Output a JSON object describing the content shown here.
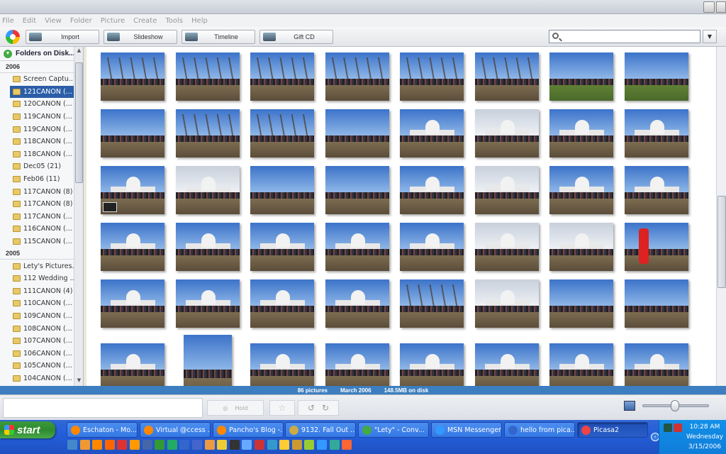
{
  "menu": [
    "File",
    "Edit",
    "View",
    "Folder",
    "Picture",
    "Create",
    "Tools",
    "Help"
  ],
  "toolbar": {
    "import": "Import",
    "slideshow": "Slideshow",
    "timeline": "Timeline",
    "giftcd": "Gift CD"
  },
  "search": {
    "value": ""
  },
  "sidebar": {
    "header": "Folders on Disk...",
    "year_2006": "2006",
    "folders_2006": [
      "Screen Captu...",
      "121CANON (...",
      "120CANON (...",
      "119CANON (...",
      "119CANON (...",
      "118CANON (...",
      "118CANON (...",
      "Dec05 (21)",
      "Feb06 (11)",
      "117CANON (8)",
      "117CANON (8)",
      "117CANON (...",
      "116CANON (...",
      "115CANON (..."
    ],
    "year_2005": "2005",
    "folders_2005": [
      "Lety's Pictures...",
      "112 Wedding ...",
      "111CANON (4)",
      "110CANON (...",
      "109CANON (...",
      "108CANON (...",
      "107CANON (...",
      "106CANON (...",
      "105CANON (...",
      "104CANON (..."
    ]
  },
  "status": {
    "count": "86 pictures",
    "month": "March 2006",
    "size": "148.5MB on disk"
  },
  "tray": {
    "hold": "Hold"
  },
  "taskbar": {
    "start": "start",
    "tasks": [
      "Eschaton - Mo...",
      "Virtual @ccess ...",
      "Pancho's Blog -...",
      "9132. Fall Out ...",
      "\"Lety\" - Conv...",
      "MSN Messenger",
      "hello from pica...",
      "Picasa2"
    ],
    "time": "10:28 AM",
    "day": "Wednesday",
    "date": "3/15/2006"
  }
}
